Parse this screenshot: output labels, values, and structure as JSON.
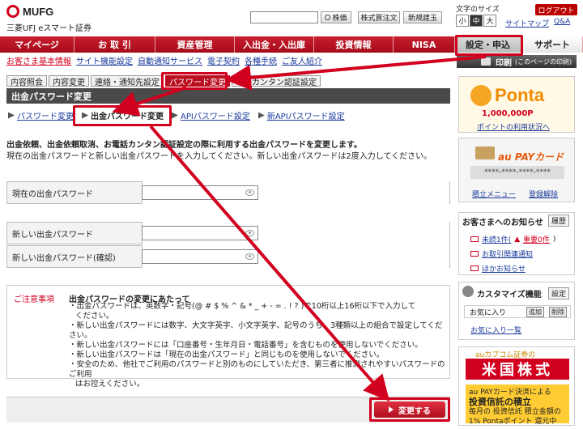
{
  "header": {
    "brand": "MUFG",
    "sub_brand": "三菱UFJ eスマート証券",
    "search_button": "株価",
    "btn_order": "株式買注文",
    "btn_new_sell": "新規建玉",
    "fontsize_label": "文字のサイズ",
    "fontsize_small": "小",
    "fontsize_mid": "中",
    "fontsize_large": "大",
    "logout": "ログアウト",
    "sitemap": "サイトマップ",
    "qa": "Q&A"
  },
  "topnav": {
    "items": [
      "マイページ",
      "お 取 引",
      "資産管理",
      "入出金・入出庫",
      "投資情報",
      "NISA",
      "設定・申込",
      "サポート"
    ]
  },
  "subnav": {
    "items": [
      "お客さま基本情報",
      "サイト機能設定",
      "自動通知サービス",
      "電子契約",
      "各種手続",
      "ご友人紹介"
    ]
  },
  "tabs": {
    "items": [
      "内容照会",
      "内容変更",
      "連絡・通知先設定",
      "パスワード変更",
      "電話カンタン認証設定"
    ]
  },
  "section": {
    "title": "出金パスワード変更"
  },
  "pw_links": {
    "items": [
      "パスワード変更",
      "出金パスワード変更",
      "APIパスワード設定",
      "新APIパスワード設定"
    ]
  },
  "description": {
    "line1": "出金依頼、出金依頼取消、お電話カンタン認証設定の際に利用する出金パスワードを変更します。",
    "line2": "現在の出金パスワードと新しい出金パスワードを入力してください。新しい出金パスワードは2度入力してください。"
  },
  "form": {
    "current_label": "現在の出金パスワード",
    "new_label": "新しい出金パスワード",
    "confirm_label": "新しい出金パスワード(確認)"
  },
  "notice": {
    "label": "ご注意事項",
    "title": "出金パスワードの変更にあたって",
    "lines": [
      "・出金パスワードは、英数字・記号(@ # $ % ^ & * _ + - = . ! ? )で10桁以上16桁以下で入力して",
      "ください。",
      "・新しい出金パスワードには数字、大文字英字、小文字英字、記号のうち、3種類以上の組合で設定してください。",
      "・新しい出金パスワードには「口座番号・生年月日・電話番号」を含むものを使用しないでください。",
      "・新しい出金パスワードは「現在の出金パスワード」と同じものを使用しないでください。",
      "・安全のため、他社でご利用のパスワードと別のものにしていただき、第三者に推測されやすいパスワードのご利用",
      "はお控えください。"
    ]
  },
  "submit_label": "変更する",
  "sidebar": {
    "print_label": "印刷",
    "print_sub": "(このページの印刷)",
    "ponta_name": "Ponta",
    "ponta_points": "1,000,000P",
    "ponta_link": "ポイントの利用状況へ",
    "aupay_label": "au PAYカード",
    "aupay_number": "****-****-****-****",
    "aupay_link1": "積立メニュー",
    "aupay_link2": "登録解除",
    "notices_title": "お客さまへのお知らせ",
    "notices_history": "履歴",
    "notice1": "未読1件(",
    "notice1_important": "重要0件",
    "notice1_end": ")",
    "notice2": "お取引関連通知",
    "notice3": "ほかお知らせ",
    "custom_title": "カスタマイズ機能",
    "custom_setting": "設定",
    "fav_label": "お気に入り",
    "fav_add": "追加",
    "fav_delete": "削除",
    "fav_list": "お気に入り一覧",
    "ad_top": "auカブコム証券の",
    "ad_main": "米国株式",
    "ad_sub1": "au PAYカード決済による",
    "ad_sub2": "投資信託の積立",
    "ad_sub3": "毎月の 投資信託 積立金額の 1% Pontaポイント 還元中"
  }
}
